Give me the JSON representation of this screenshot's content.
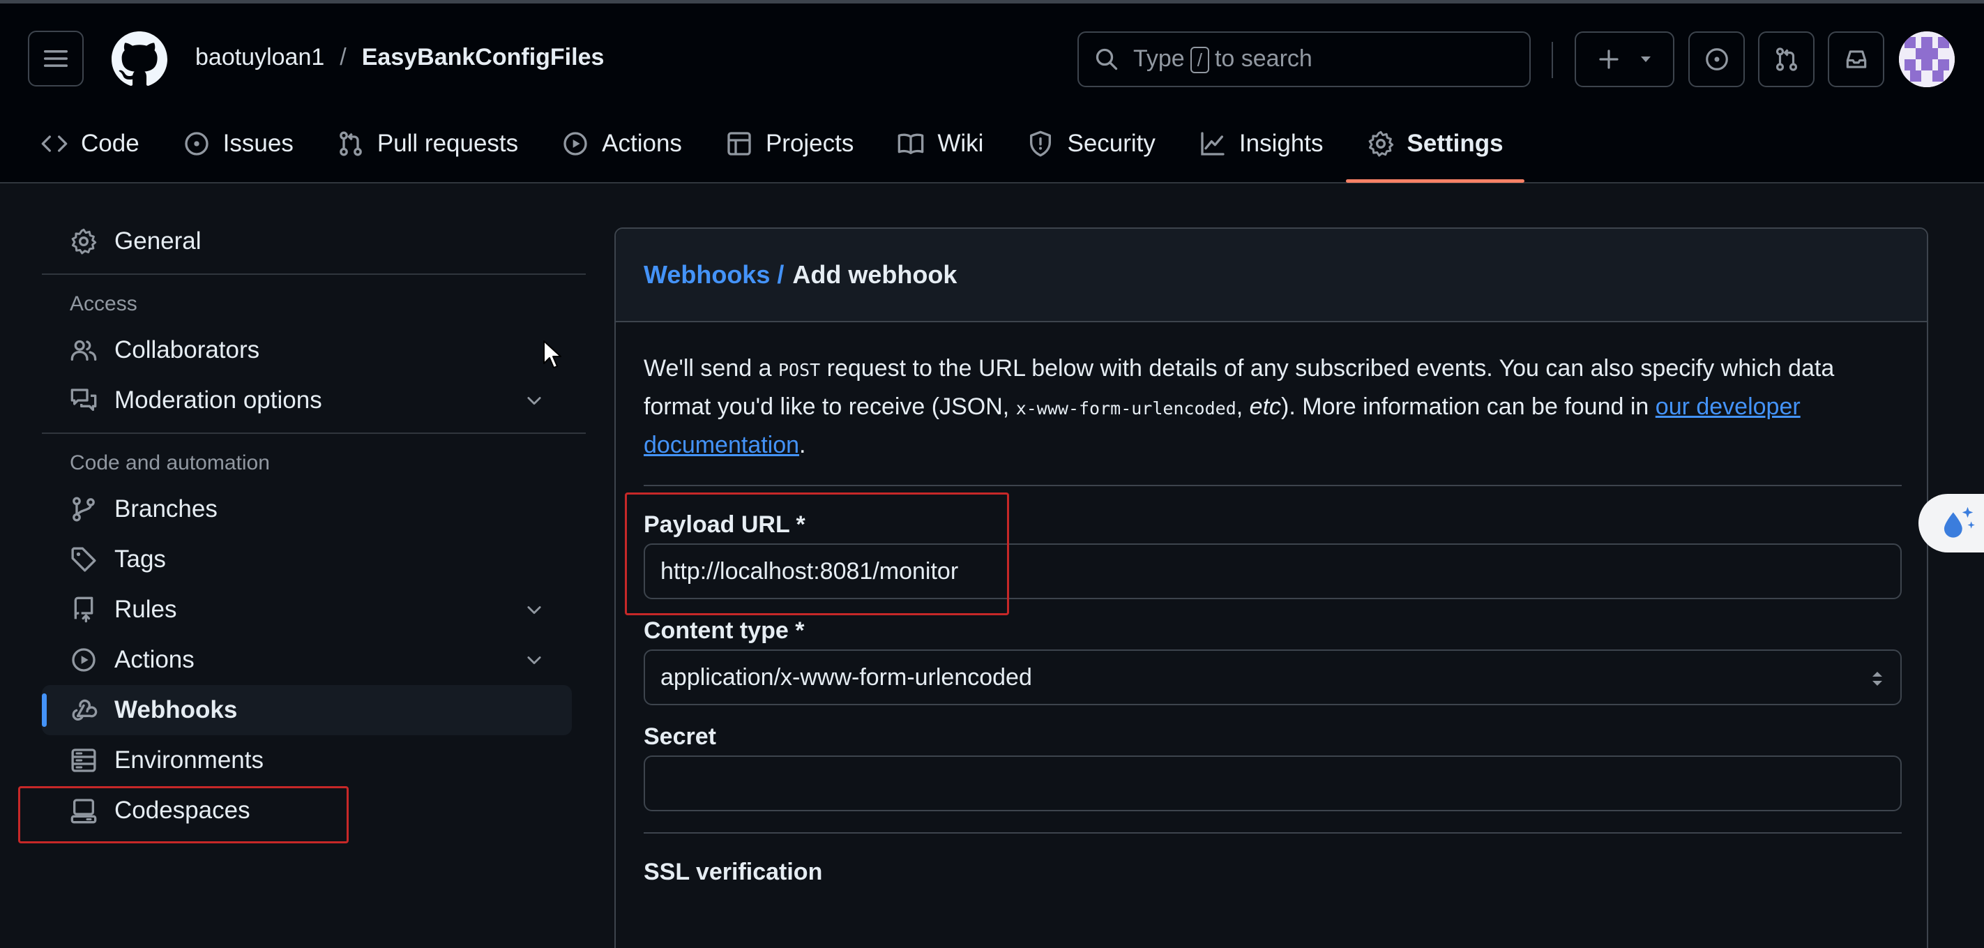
{
  "header": {
    "owner": "baotuyloan1",
    "separator": "/",
    "repo": "EasyBankConfigFiles",
    "search": {
      "prefix": "Type",
      "key": "/",
      "suffix": "to search"
    }
  },
  "repo_nav": {
    "tabs": [
      {
        "label": "Code",
        "icon": "code-icon"
      },
      {
        "label": "Issues",
        "icon": "issue-opened-icon"
      },
      {
        "label": "Pull requests",
        "icon": "git-pull-request-icon"
      },
      {
        "label": "Actions",
        "icon": "play-icon"
      },
      {
        "label": "Projects",
        "icon": "table-icon"
      },
      {
        "label": "Wiki",
        "icon": "book-icon"
      },
      {
        "label": "Security",
        "icon": "shield-icon"
      },
      {
        "label": "Insights",
        "icon": "graph-icon"
      },
      {
        "label": "Settings",
        "icon": "gear-icon",
        "active": true
      }
    ]
  },
  "sidebar": {
    "general": "General",
    "access_heading": "Access",
    "collaborators": "Collaborators",
    "moderation": "Moderation options",
    "automation_heading": "Code and automation",
    "branches": "Branches",
    "tags": "Tags",
    "rules": "Rules",
    "actions": "Actions",
    "webhooks": "Webhooks",
    "environments": "Environments",
    "codespaces": "Codespaces",
    "selected": "Webhooks"
  },
  "main": {
    "breadcrumb_link": "Webhooks /",
    "breadcrumb_current": "Add webhook",
    "intro_1": "We'll send a",
    "intro_post": "POST",
    "intro_2": "request to the URL below with details of any subscribed events. You can also specify which data format you'd like to receive (JSON,",
    "intro_mono": "x-www-form-urlencoded",
    "intro_3": ",",
    "intro_etc": "etc",
    "intro_4": "). More information can be found in",
    "intro_link": "our developer documentation",
    "intro_end": ".",
    "payload_label": "Payload URL *",
    "payload_value": "http://localhost:8081/monitor",
    "content_type_label": "Content type *",
    "content_type_value": "application/x-www-form-urlencoded",
    "secret_label": "Secret",
    "secret_value": "",
    "ssl_label": "SSL verification"
  },
  "colors": {
    "background": "#0d1117",
    "header_bg": "#010409",
    "accent_link": "#4493f8",
    "active_tab_underline": "#f78166",
    "highlight_box": "#c62828"
  }
}
